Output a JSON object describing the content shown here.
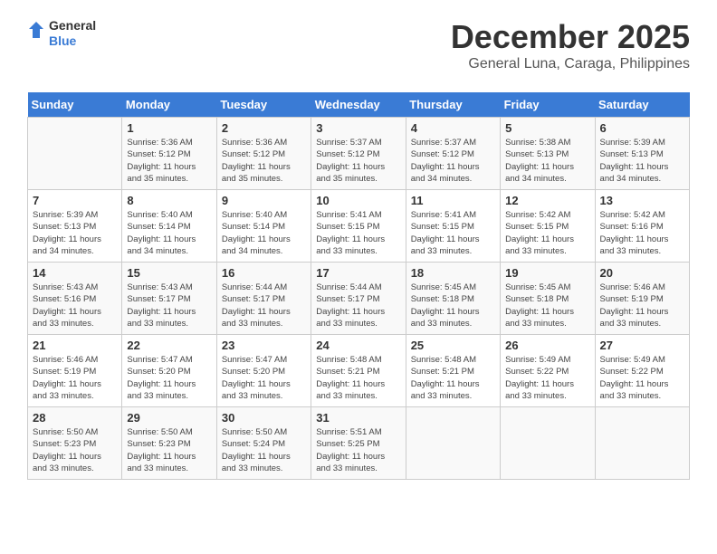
{
  "header": {
    "logo_general": "General",
    "logo_blue": "Blue",
    "month_year": "December 2025",
    "location": "General Luna, Caraga, Philippines"
  },
  "days_of_week": [
    "Sunday",
    "Monday",
    "Tuesday",
    "Wednesday",
    "Thursday",
    "Friday",
    "Saturday"
  ],
  "weeks": [
    [
      {
        "day": "",
        "sunrise": "",
        "sunset": "",
        "daylight": ""
      },
      {
        "day": "1",
        "sunrise": "Sunrise: 5:36 AM",
        "sunset": "Sunset: 5:12 PM",
        "daylight": "Daylight: 11 hours and 35 minutes."
      },
      {
        "day": "2",
        "sunrise": "Sunrise: 5:36 AM",
        "sunset": "Sunset: 5:12 PM",
        "daylight": "Daylight: 11 hours and 35 minutes."
      },
      {
        "day": "3",
        "sunrise": "Sunrise: 5:37 AM",
        "sunset": "Sunset: 5:12 PM",
        "daylight": "Daylight: 11 hours and 35 minutes."
      },
      {
        "day": "4",
        "sunrise": "Sunrise: 5:37 AM",
        "sunset": "Sunset: 5:12 PM",
        "daylight": "Daylight: 11 hours and 34 minutes."
      },
      {
        "day": "5",
        "sunrise": "Sunrise: 5:38 AM",
        "sunset": "Sunset: 5:13 PM",
        "daylight": "Daylight: 11 hours and 34 minutes."
      },
      {
        "day": "6",
        "sunrise": "Sunrise: 5:39 AM",
        "sunset": "Sunset: 5:13 PM",
        "daylight": "Daylight: 11 hours and 34 minutes."
      }
    ],
    [
      {
        "day": "7",
        "sunrise": "Sunrise: 5:39 AM",
        "sunset": "Sunset: 5:13 PM",
        "daylight": "Daylight: 11 hours and 34 minutes."
      },
      {
        "day": "8",
        "sunrise": "Sunrise: 5:40 AM",
        "sunset": "Sunset: 5:14 PM",
        "daylight": "Daylight: 11 hours and 34 minutes."
      },
      {
        "day": "9",
        "sunrise": "Sunrise: 5:40 AM",
        "sunset": "Sunset: 5:14 PM",
        "daylight": "Daylight: 11 hours and 34 minutes."
      },
      {
        "day": "10",
        "sunrise": "Sunrise: 5:41 AM",
        "sunset": "Sunset: 5:15 PM",
        "daylight": "Daylight: 11 hours and 33 minutes."
      },
      {
        "day": "11",
        "sunrise": "Sunrise: 5:41 AM",
        "sunset": "Sunset: 5:15 PM",
        "daylight": "Daylight: 11 hours and 33 minutes."
      },
      {
        "day": "12",
        "sunrise": "Sunrise: 5:42 AM",
        "sunset": "Sunset: 5:15 PM",
        "daylight": "Daylight: 11 hours and 33 minutes."
      },
      {
        "day": "13",
        "sunrise": "Sunrise: 5:42 AM",
        "sunset": "Sunset: 5:16 PM",
        "daylight": "Daylight: 11 hours and 33 minutes."
      }
    ],
    [
      {
        "day": "14",
        "sunrise": "Sunrise: 5:43 AM",
        "sunset": "Sunset: 5:16 PM",
        "daylight": "Daylight: 11 hours and 33 minutes."
      },
      {
        "day": "15",
        "sunrise": "Sunrise: 5:43 AM",
        "sunset": "Sunset: 5:17 PM",
        "daylight": "Daylight: 11 hours and 33 minutes."
      },
      {
        "day": "16",
        "sunrise": "Sunrise: 5:44 AM",
        "sunset": "Sunset: 5:17 PM",
        "daylight": "Daylight: 11 hours and 33 minutes."
      },
      {
        "day": "17",
        "sunrise": "Sunrise: 5:44 AM",
        "sunset": "Sunset: 5:17 PM",
        "daylight": "Daylight: 11 hours and 33 minutes."
      },
      {
        "day": "18",
        "sunrise": "Sunrise: 5:45 AM",
        "sunset": "Sunset: 5:18 PM",
        "daylight": "Daylight: 11 hours and 33 minutes."
      },
      {
        "day": "19",
        "sunrise": "Sunrise: 5:45 AM",
        "sunset": "Sunset: 5:18 PM",
        "daylight": "Daylight: 11 hours and 33 minutes."
      },
      {
        "day": "20",
        "sunrise": "Sunrise: 5:46 AM",
        "sunset": "Sunset: 5:19 PM",
        "daylight": "Daylight: 11 hours and 33 minutes."
      }
    ],
    [
      {
        "day": "21",
        "sunrise": "Sunrise: 5:46 AM",
        "sunset": "Sunset: 5:19 PM",
        "daylight": "Daylight: 11 hours and 33 minutes."
      },
      {
        "day": "22",
        "sunrise": "Sunrise: 5:47 AM",
        "sunset": "Sunset: 5:20 PM",
        "daylight": "Daylight: 11 hours and 33 minutes."
      },
      {
        "day": "23",
        "sunrise": "Sunrise: 5:47 AM",
        "sunset": "Sunset: 5:20 PM",
        "daylight": "Daylight: 11 hours and 33 minutes."
      },
      {
        "day": "24",
        "sunrise": "Sunrise: 5:48 AM",
        "sunset": "Sunset: 5:21 PM",
        "daylight": "Daylight: 11 hours and 33 minutes."
      },
      {
        "day": "25",
        "sunrise": "Sunrise: 5:48 AM",
        "sunset": "Sunset: 5:21 PM",
        "daylight": "Daylight: 11 hours and 33 minutes."
      },
      {
        "day": "26",
        "sunrise": "Sunrise: 5:49 AM",
        "sunset": "Sunset: 5:22 PM",
        "daylight": "Daylight: 11 hours and 33 minutes."
      },
      {
        "day": "27",
        "sunrise": "Sunrise: 5:49 AM",
        "sunset": "Sunset: 5:22 PM",
        "daylight": "Daylight: 11 hours and 33 minutes."
      }
    ],
    [
      {
        "day": "28",
        "sunrise": "Sunrise: 5:50 AM",
        "sunset": "Sunset: 5:23 PM",
        "daylight": "Daylight: 11 hours and 33 minutes."
      },
      {
        "day": "29",
        "sunrise": "Sunrise: 5:50 AM",
        "sunset": "Sunset: 5:23 PM",
        "daylight": "Daylight: 11 hours and 33 minutes."
      },
      {
        "day": "30",
        "sunrise": "Sunrise: 5:50 AM",
        "sunset": "Sunset: 5:24 PM",
        "daylight": "Daylight: 11 hours and 33 minutes."
      },
      {
        "day": "31",
        "sunrise": "Sunrise: 5:51 AM",
        "sunset": "Sunset: 5:25 PM",
        "daylight": "Daylight: 11 hours and 33 minutes."
      },
      {
        "day": "",
        "sunrise": "",
        "sunset": "",
        "daylight": ""
      },
      {
        "day": "",
        "sunrise": "",
        "sunset": "",
        "daylight": ""
      },
      {
        "day": "",
        "sunrise": "",
        "sunset": "",
        "daylight": ""
      }
    ]
  ]
}
